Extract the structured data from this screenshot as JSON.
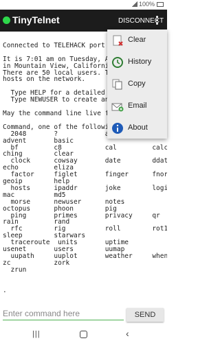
{
  "status_bar": {
    "battery": "100%"
  },
  "app_bar": {
    "title": "TinyTelnet",
    "disconnect_label": "DISCONNECT"
  },
  "terminal": {
    "text": "\nConnected to TELEHACK port 2\n\nIt is 7:01 am on Tuesday, Au\nin Mountain View, California\nThere are 50 local users. Th\nhosts on the network.\n\n  Type HELP for a detailed c\n  Type NEWUSER to create an\n\nMay the command line live fo\n\nCommand, one of the followin\n  2048       ?            a2\nadvent       basic\n  bf         c8           cal         calc\nching        clear\n  clock      cowsay       date        ddate\necho         eliza\n  factor     figlet       finger      fnord\ngeoip        help\n  hosts      ipaddr       joke        login\nmac          md5\n  morse      newuser      notes\noctopus      phoon        pig\n  ping       primes       privacy     qr\nrain         rand\n  rfc        rig          roll        rot13\nsleep        starwars\n  traceroute  units       uptime\nusenet       users        uumap\n  uupath     uuplot       weather     when\nzc           zork\n  zrun\n\n\n."
  },
  "input": {
    "placeholder": "Enter command here",
    "send_label": "SEND"
  },
  "menu": {
    "items": [
      {
        "label": "Clear",
        "icon": "clear-icon"
      },
      {
        "label": "History",
        "icon": "history-icon"
      },
      {
        "label": "Copy",
        "icon": "copy-icon"
      },
      {
        "label": "Email",
        "icon": "email-icon"
      },
      {
        "label": "About",
        "icon": "info-icon"
      }
    ]
  }
}
